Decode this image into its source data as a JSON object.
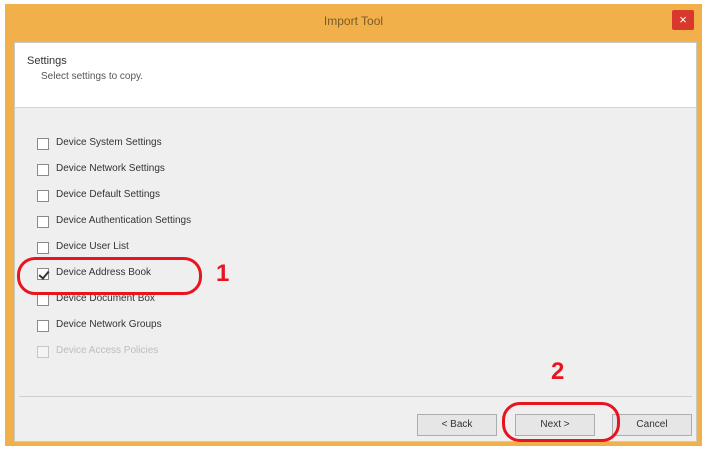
{
  "window": {
    "title": "Import Tool",
    "close_glyph": "×"
  },
  "header": {
    "title": "Settings",
    "subtitle": "Select settings to copy."
  },
  "options": [
    {
      "label": "Device System Settings",
      "checked": false,
      "enabled": true
    },
    {
      "label": "Device Network Settings",
      "checked": false,
      "enabled": true
    },
    {
      "label": "Device Default Settings",
      "checked": false,
      "enabled": true
    },
    {
      "label": "Device Authentication Settings",
      "checked": false,
      "enabled": true
    },
    {
      "label": "Device User List",
      "checked": false,
      "enabled": true
    },
    {
      "label": "Device Address Book",
      "checked": true,
      "enabled": true
    },
    {
      "label": "Device Document Box",
      "checked": false,
      "enabled": true
    },
    {
      "label": "Device Network Groups",
      "checked": false,
      "enabled": true
    },
    {
      "label": "Device Access Policies",
      "checked": false,
      "enabled": false
    }
  ],
  "buttons": {
    "back": "< Back",
    "next": "Next >",
    "cancel": "Cancel"
  },
  "callouts": {
    "step1": "1",
    "step2": "2"
  },
  "colors": {
    "titlebar": "#f2b04a",
    "callout": "#e8141f",
    "close": "#d9382c"
  }
}
